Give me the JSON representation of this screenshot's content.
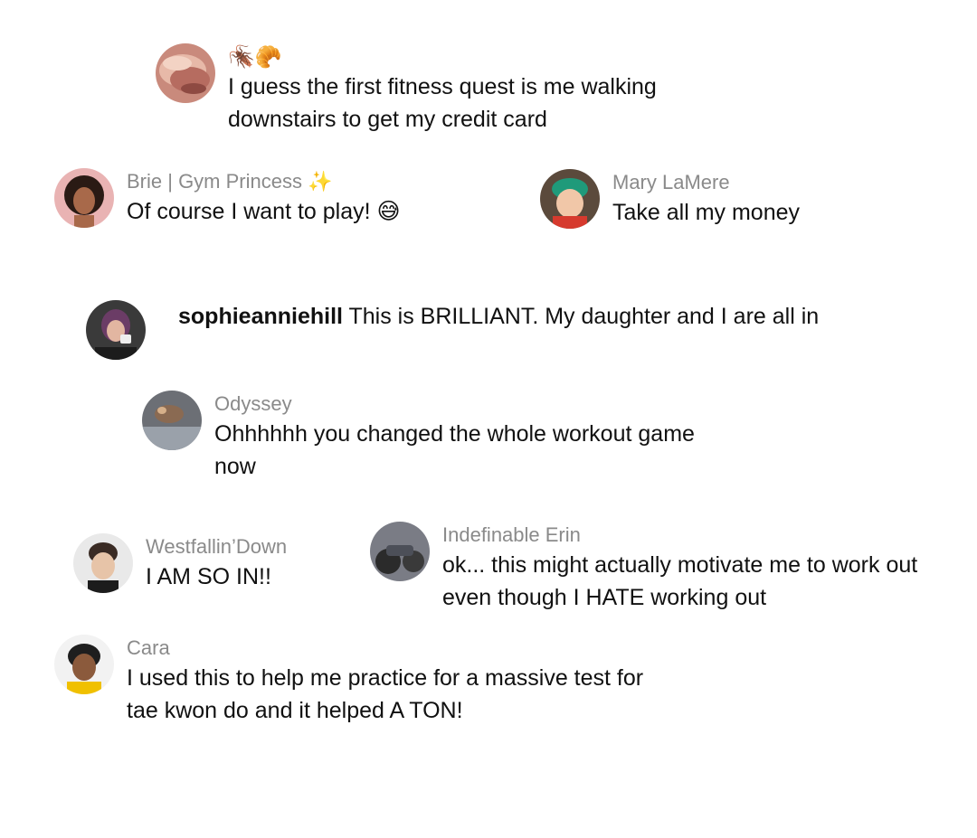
{
  "comments": [
    {
      "name": "🪳🥐",
      "text": "I guess the first fitness quest is me walking downstairs to get my credit card",
      "avatar": "mushroom"
    },
    {
      "name": "Brie | Gym  Princess ✨",
      "text": "Of course I want to play! 😅",
      "avatar": "curly-hair"
    },
    {
      "name": "Mary LaMere",
      "text": "Take all my money",
      "avatar": "green-hair"
    },
    {
      "name": "sophieanniehill",
      "text": "This is BRILLIANT. My daughter and I are all in",
      "avatar": "coffee-person"
    },
    {
      "name": "Odyssey",
      "text": "Ohhhhhh you changed the whole workout game now",
      "avatar": "dog"
    },
    {
      "name": "Westfallin’Down",
      "text": "I AM SO IN!!",
      "avatar": "woman-bun"
    },
    {
      "name": "Indefinable Erin",
      "text": "ok... this might actually motivate me to work out even though I HATE working out",
      "avatar": "motorbike"
    },
    {
      "name": "Cara",
      "text": "I used this to help me practice for a massive test for tae kwon do and it helped A TON!",
      "avatar": "cartoon"
    }
  ]
}
